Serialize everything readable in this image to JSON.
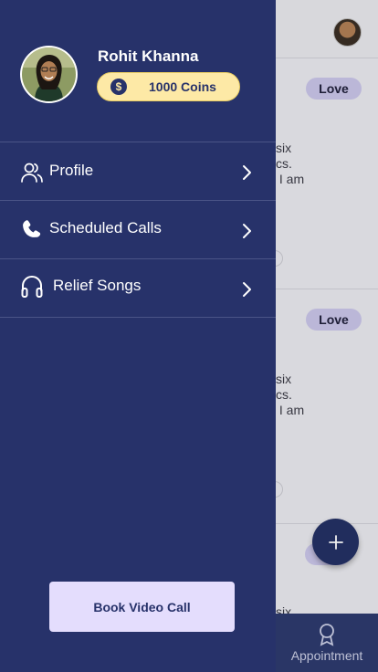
{
  "background": {
    "cards": [
      {
        "tag": "Love",
        "text": "six\ncs.\n I am"
      },
      {
        "tag": "Love",
        "text": "six\ncs.\n I am"
      },
      {
        "tag": "",
        "text": "six"
      }
    ],
    "fab_icon": "plus-icon",
    "tab_appointment_label": "Appointment",
    "tab_appointment_icon": "award-ribbon-icon"
  },
  "drawer": {
    "user": {
      "name": "Rohit Khanna",
      "coins_label": "1000 Coins",
      "coin_symbol": "$"
    },
    "menu": [
      {
        "label": "Profile",
        "icon": "users-icon"
      },
      {
        "label": "Scheduled Calls",
        "icon": "phone-icon"
      },
      {
        "label": "Relief Songs",
        "icon": "headphones-icon"
      }
    ],
    "book_button_label": "Book Video Call"
  },
  "colors": {
    "drawer_bg": "#27326a",
    "coins_bg": "#fde9a6",
    "button_bg": "#e4ddfd",
    "tag_bg": "#c7c3e6"
  }
}
